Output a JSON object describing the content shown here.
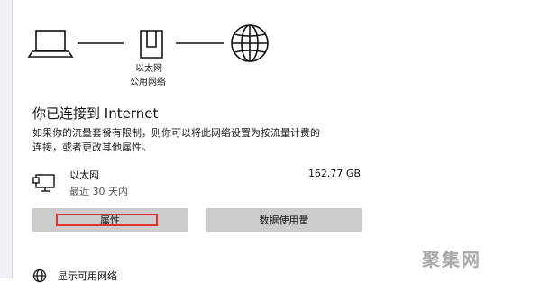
{
  "diagram": {
    "laptop_icon": "laptop-icon",
    "ethernet_icon": "ethernet-port-icon",
    "globe_icon": "globe-icon",
    "ethernet_label_line1": "以太网",
    "ethernet_label_line2": "公用网络"
  },
  "status": {
    "heading": "你已连接到 Internet",
    "desc_line1": "如果你的流量套餐有限制，则你可以将此网络设置为按流量计费的",
    "desc_line2": "连接，或者更改其他属性。"
  },
  "network": {
    "icon": "wired-network-icon",
    "name": "以太网",
    "sub": "最近 30 天内",
    "usage": "162.77 GB"
  },
  "buttons": {
    "properties": "属性",
    "data_usage": "数据使用量"
  },
  "show_networks": {
    "icon": "globe-icon",
    "label": "显示可用网络"
  },
  "watermark": "聚集网",
  "colors": {
    "highlight": "#e23030",
    "button_bg": "#cccccc"
  }
}
